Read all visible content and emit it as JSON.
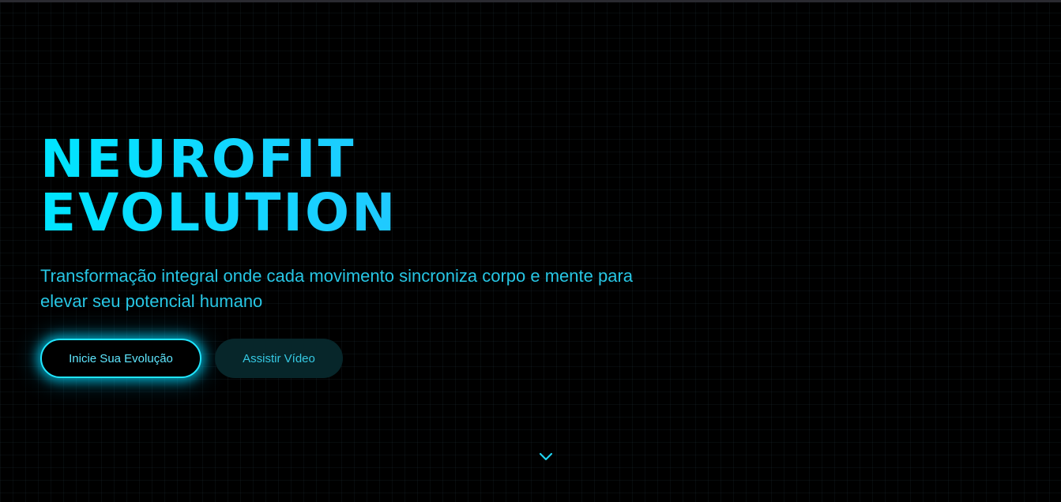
{
  "hero": {
    "title_line1": "NEUROFIT",
    "title_line2": "EVOLUTION",
    "subtitle": "Transformação integral onde cada movimento sincroniza corpo e mente para elevar seu potencial humano"
  },
  "cta": {
    "primary_label": "Inicie Sua Evolução",
    "secondary_label": "Assistir Vídeo"
  },
  "scroll": {
    "icon": "chevron-down-icon"
  },
  "colors": {
    "accent": "#00e5ff",
    "background": "#000000",
    "secondary_button_bg": "#07262a"
  }
}
